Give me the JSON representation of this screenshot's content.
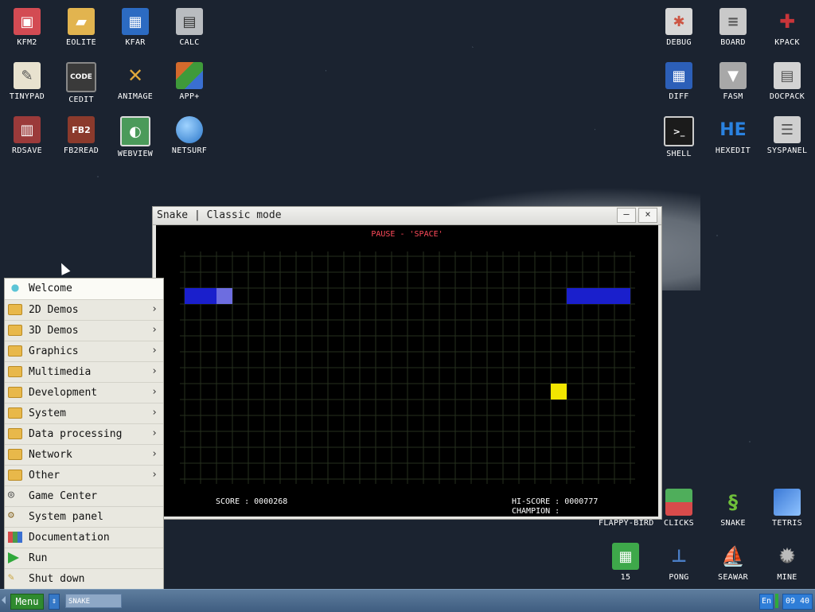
{
  "desktop_icons": [
    {
      "id": "kfm2",
      "label": "KFM2",
      "icon": "floppy-icon",
      "color": "#d34b53"
    },
    {
      "id": "eolite",
      "label": "EOLITE",
      "icon": "folder-icon",
      "color": "#e2b44f"
    },
    {
      "id": "kfar",
      "label": "KFAR",
      "icon": "kfar-icon",
      "color": "#2c6bc2"
    },
    {
      "id": "calc",
      "label": "CALC",
      "icon": "calculator-icon",
      "color": "#b9bcc0"
    },
    {
      "id": "tinypad",
      "label": "TINYPAD",
      "icon": "notepad-icon",
      "color": "#e8e2cf"
    },
    {
      "id": "cedit",
      "label": "CEDIT",
      "icon": "code-icon",
      "color": "#3a3a3a"
    },
    {
      "id": "animage",
      "label": "ANIMAGE",
      "icon": "pencil-ruler-icon",
      "color": "#e0a83b"
    },
    {
      "id": "app_plus",
      "label": "APP+",
      "icon": "cube-icon",
      "color": "#d46a2c"
    },
    {
      "id": "rdsave",
      "label": "RDSAVE",
      "icon": "disk-save-icon",
      "color": "#9b3a3a"
    },
    {
      "id": "fb2read",
      "label": "FB2READ",
      "icon": "book-icon",
      "color": "#8b3a2c"
    },
    {
      "id": "webview",
      "label": "WEBVIEW",
      "icon": "webpage-icon",
      "color": "#4b9a5a"
    },
    {
      "id": "netsurf",
      "label": "NETSURF",
      "icon": "globe-icon",
      "color": "#3a8fd8"
    },
    {
      "id": "debug",
      "label": "DEBUG",
      "icon": "bug-icon",
      "color": "#d7d7d7"
    },
    {
      "id": "board",
      "label": "BOARD",
      "icon": "board-icon",
      "color": "#c9c9c9"
    },
    {
      "id": "kpack",
      "label": "KPACK",
      "icon": "wrench-icon",
      "color": "#c9353a"
    },
    {
      "id": "diff",
      "label": "DIFF",
      "icon": "diff-icon",
      "color": "#2c5fb8"
    },
    {
      "id": "fasm",
      "label": "FASM",
      "icon": "fasm-icon",
      "color": "#a8a8a8"
    },
    {
      "id": "docpack",
      "label": "DOCPACK",
      "icon": "cabinet-icon",
      "color": "#d3d3d3"
    },
    {
      "id": "shell",
      "label": "SHELL",
      "icon": "terminal-icon",
      "color": "#1b1b1b"
    },
    {
      "id": "hexedit",
      "label": "HEXEDIT",
      "icon": "hex-icon",
      "color": "#2a82e0"
    },
    {
      "id": "syspanel",
      "label": "SYSPANEL",
      "icon": "sliders-icon",
      "color": "#cfcfcf"
    },
    {
      "id": "flappy_bird",
      "label": "FLAPPY-BIRD",
      "icon": "",
      "color": ""
    },
    {
      "id": "clicks",
      "label": "CLICKS",
      "icon": "blocks-icon",
      "color": "#4fae5b"
    },
    {
      "id": "snake",
      "label": "SNAKE",
      "icon": "snake-icon",
      "color": "#3a7d2a"
    },
    {
      "id": "tetris",
      "label": "TETRIS",
      "icon": "tetris-icon",
      "color": "#3b79d6"
    },
    {
      "id": "fifteen",
      "label": "15",
      "icon": "grid15-icon",
      "color": "#3ea84a"
    },
    {
      "id": "pong",
      "label": "PONG",
      "icon": "pong-icon",
      "color": "#4a7dc5"
    },
    {
      "id": "seawar",
      "label": "SEAWAR",
      "icon": "ship-icon",
      "color": "#7a8a9a"
    },
    {
      "id": "mine",
      "label": "MINE",
      "icon": "mine-icon",
      "color": "#8a8a8a"
    }
  ],
  "snake_window": {
    "title": "Snake | Classic mode",
    "minimize": "–",
    "close": "×",
    "pause_text": "PAUSE - 'SPACE'",
    "score": "SCORE : 0000268",
    "hi_score": "HI-SCORE : 0000777",
    "champion": "CHAMPION :",
    "grid": {
      "cols": 28,
      "rows": 14
    },
    "snake_cells": [
      [
        0,
        2
      ],
      [
        1,
        2
      ],
      [
        2,
        2
      ],
      [
        24,
        2
      ],
      [
        25,
        2
      ],
      [
        26,
        2
      ],
      [
        27,
        2
      ]
    ],
    "snake_head": [
      2,
      2
    ],
    "food": [
      23,
      8
    ],
    "colors": {
      "snake": "#1a1fcc",
      "head": "#6d6de0",
      "food": "#f2e600",
      "grid": "#26301e"
    }
  },
  "start_menu": {
    "items": [
      {
        "label": "Welcome",
        "icon": "welcome-icon",
        "submenu": false,
        "arrow": ""
      },
      {
        "label": "2D Demos",
        "icon": "folder-icon",
        "submenu": true,
        "arrow": "›"
      },
      {
        "label": "3D Demos",
        "icon": "folder-icon",
        "submenu": true,
        "arrow": "›"
      },
      {
        "label": "Graphics",
        "icon": "folder-icon",
        "submenu": true,
        "arrow": "›"
      },
      {
        "label": "Multimedia",
        "icon": "folder-icon",
        "submenu": true,
        "arrow": "›"
      },
      {
        "label": "Development",
        "icon": "folder-icon",
        "submenu": true,
        "arrow": "›"
      },
      {
        "label": "System",
        "icon": "folder-icon",
        "submenu": true,
        "arrow": "›"
      },
      {
        "label": "Data processing",
        "icon": "folder-icon",
        "submenu": true,
        "arrow": "›"
      },
      {
        "label": "Network",
        "icon": "folder-icon",
        "submenu": true,
        "arrow": "›"
      },
      {
        "label": "Other",
        "icon": "folder-icon",
        "submenu": true,
        "arrow": "›"
      },
      {
        "label": "Game Center",
        "icon": "gamepad-icon",
        "submenu": false,
        "arrow": ""
      },
      {
        "label": "System panel",
        "icon": "gears-icon",
        "submenu": false,
        "arrow": ""
      },
      {
        "label": "Documentation",
        "icon": "books-icon",
        "submenu": false,
        "arrow": ""
      },
      {
        "label": "Run",
        "icon": "play-icon",
        "submenu": false,
        "arrow": ""
      },
      {
        "label": "Shut down",
        "icon": "shutdown-icon",
        "submenu": false,
        "arrow": ""
      }
    ]
  },
  "taskbar": {
    "menu_label": "Menu",
    "switch_label": "⇕",
    "task_label": "SNAKE",
    "lang": "En",
    "clock": "09 40"
  }
}
